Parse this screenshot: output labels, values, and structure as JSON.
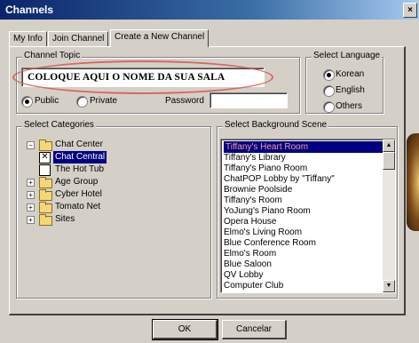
{
  "window": {
    "title": "Channels",
    "close_glyph": "×"
  },
  "tabs": [
    {
      "label": "My Info"
    },
    {
      "label": "Join Channel"
    },
    {
      "label": "Create a New Channel"
    }
  ],
  "channel_topic": {
    "legend": "Channel Topic",
    "value": "COLOQUE AQUI O NOME DA SUA SALA",
    "public_label": "Public",
    "private_label": "Private",
    "selected": "Public",
    "password_label": "Password",
    "password_value": ""
  },
  "language": {
    "legend": "Select Language",
    "options": [
      "Korean",
      "English",
      "Others"
    ],
    "selected": "Korean"
  },
  "categories": {
    "legend": "Select Categories",
    "items": [
      {
        "label": "Chat Center",
        "expander": "−",
        "expanded": true
      },
      {
        "label": "Chat Central",
        "checked": true,
        "selected": true
      },
      {
        "label": "The Hot Tub",
        "checked": false
      },
      {
        "label": "Age Group",
        "expander": "+"
      },
      {
        "label": "Cyber Hotel",
        "expander": "+"
      },
      {
        "label": "Tomato Net",
        "expander": "+"
      },
      {
        "label": "Sites",
        "expander": "+"
      }
    ]
  },
  "background_scene": {
    "legend": "Select Background Scene",
    "items": [
      "Tiffany's Heart Room",
      "Tiffany's Library",
      "Tiffany's Piano Room",
      "ChatPOP Lobby by \"Tiffany\"",
      "Brownie Poolside",
      "Tiffany's Room",
      "YoJung's Piano Room",
      "Opera House",
      "Elmo's Living Room",
      "Blue Conference Room",
      "Elmo's Room",
      "Blue Saloon",
      "QV Lobby",
      "Computer Club"
    ],
    "selected": "Tiffany's Heart Room"
  },
  "buttons": {
    "ok": "OK",
    "cancel": "Cancelar"
  },
  "colors": {
    "selection": "#000080",
    "annotation_ellipse": "#d9534f"
  }
}
